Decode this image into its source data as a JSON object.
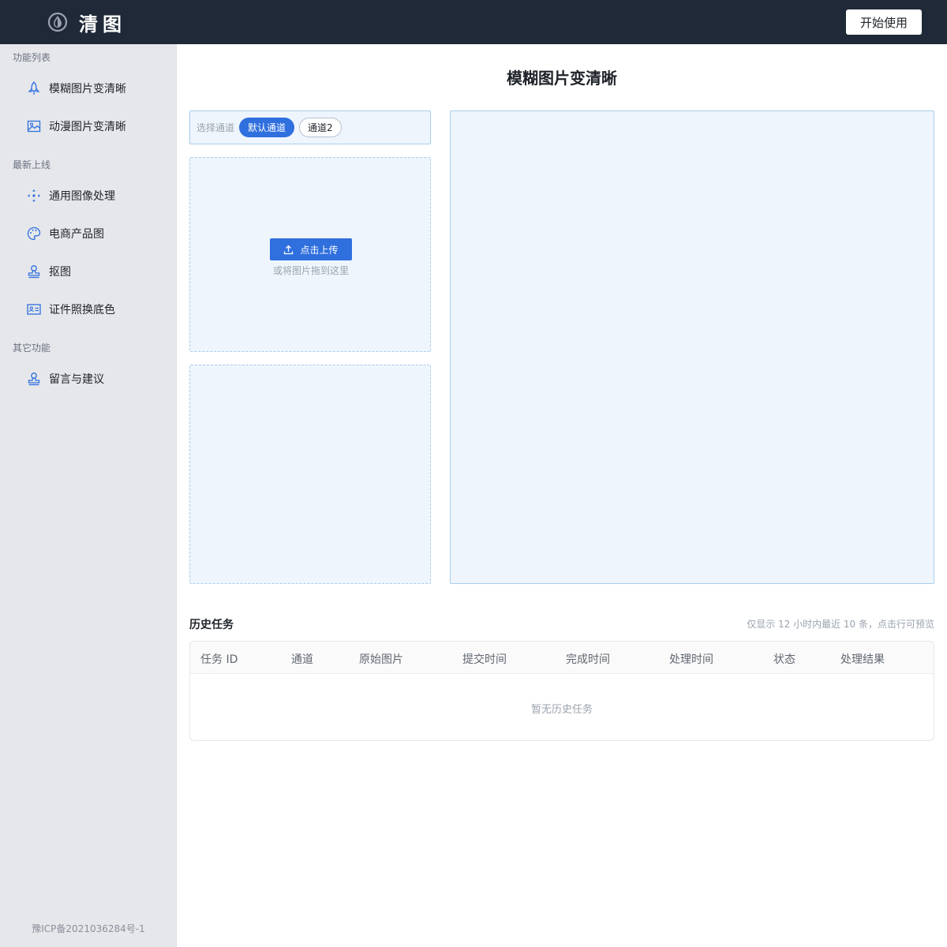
{
  "header": {
    "brand": "清图",
    "logo_icon": "water-drop-icon",
    "start_button": "开始使用"
  },
  "sidebar": {
    "groups": [
      {
        "title": "功能列表",
        "items": [
          {
            "label": "模糊图片变清晰",
            "icon": "rocket-icon"
          },
          {
            "label": "动漫图片变清晰",
            "icon": "image-icon"
          }
        ]
      },
      {
        "title": "最新上线",
        "items": [
          {
            "label": "通用图像处理",
            "icon": "move-arrows-icon"
          },
          {
            "label": "电商产品图",
            "icon": "palette-icon"
          },
          {
            "label": "抠图",
            "icon": "stamp-icon"
          },
          {
            "label": "证件照换底色",
            "icon": "id-card-icon"
          }
        ]
      },
      {
        "title": "其它功能",
        "items": [
          {
            "label": "留言与建议",
            "icon": "stamp-icon"
          }
        ]
      }
    ],
    "footer": "豫ICP备2021036284号-1"
  },
  "main": {
    "title": "模糊图片变清晰",
    "channel": {
      "label": "选择通道",
      "options": [
        "默认通道",
        "通道2"
      ],
      "selected": "默认通道"
    },
    "upload": {
      "button": "点击上传",
      "hint": "或将图片拖到这里",
      "icon": "upload-icon"
    },
    "history": {
      "title": "历史任务",
      "note": "仅显示 12 小时内最近 10 条，点击行可预览",
      "columns": [
        "任务 ID",
        "通道",
        "原始图片",
        "提交时间",
        "完成时间",
        "处理时间",
        "状态",
        "处理结果"
      ],
      "empty": "暂无历史任务"
    }
  },
  "colors": {
    "header_bg": "#1f2937",
    "sidebar_bg": "#e5e7eb",
    "accent": "#2f6fde",
    "panel_bg": "#eef5fd",
    "panel_border": "#a9cdea"
  }
}
